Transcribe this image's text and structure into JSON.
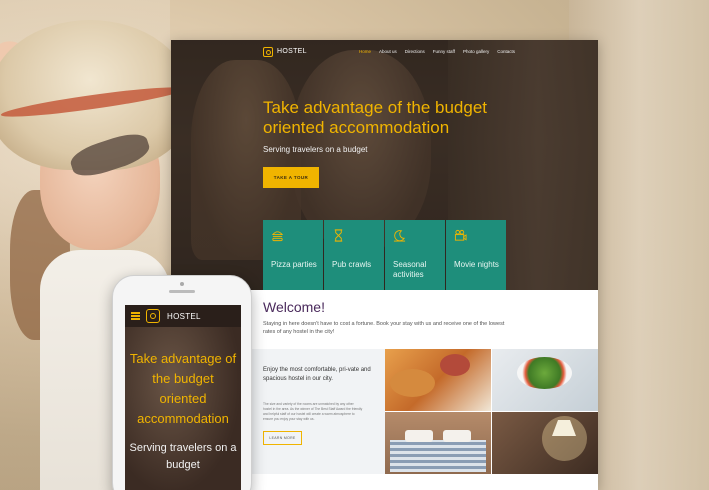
{
  "desktop": {
    "brand": "HOSTEL",
    "nav": [
      "Home",
      "About us",
      "Directions",
      "Funny staff",
      "Photo gallery",
      "Contacts"
    ],
    "hero": {
      "title": "Take advantage of the budget oriented accommodation",
      "subtitle": "Serving travelers on a budget",
      "cta": "TAKE A TOUR"
    },
    "features": [
      {
        "label": "Pizza parties",
        "icon": "burger-icon"
      },
      {
        "label": "Pub crawls",
        "icon": "hourglass-icon"
      },
      {
        "label": "Seasonal activities",
        "icon": "moon-icon"
      },
      {
        "label": "Movie nights",
        "icon": "camera-icon"
      }
    ],
    "welcome": {
      "title": "Welcome!",
      "text": "Staying in here doesn't have to cost a fortune. Book your stay with us and receive one of the lowest rates of any hostel in the city!"
    },
    "promo": {
      "title": "Enjoy the most comfortable, pri-vate and spacious hostel in our city.",
      "body": "The size and variety of the rooms are unmatched by any other hostel in the area. As the winner of The Best Staff Award the friendly and helpful staff of our hostel will create a warm atmosphere to ensure you enjoy your stay with us.",
      "button": "LEARN MORE"
    }
  },
  "mobile": {
    "brand": "HOSTEL",
    "title": "Take advantage of the budget oriented accommodation",
    "subtitle": "Serving travelers on a budget"
  },
  "colors": {
    "accent": "#f0b400",
    "teal": "#1e8e7b",
    "heading_purple": "#4a2a5c"
  }
}
